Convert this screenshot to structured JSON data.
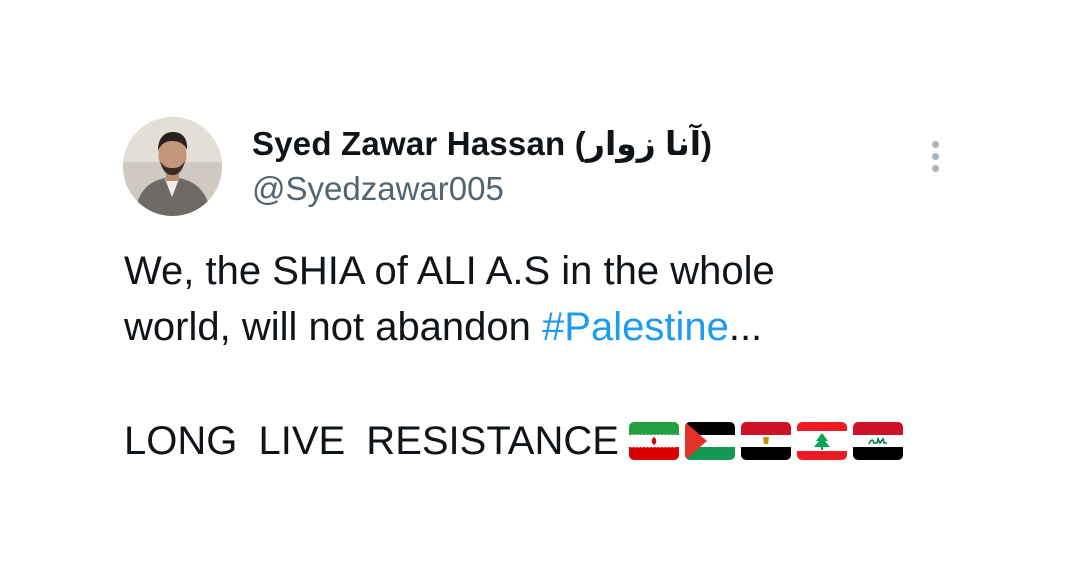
{
  "tweet": {
    "author_name": "Syed Zawar Hassan (آنا زوار)",
    "author_handle": "@Syedzawar005",
    "text_part1": "We, the SHIA of ALI A.S in the whole",
    "text_part2": "world, will not abandon ",
    "hashtag": "#Palestine",
    "ellipsis": "...",
    "text_line3": "LONG  LIVE  RESISTANCE",
    "flags": [
      "iran-flag",
      "palestine-flag",
      "egypt-flag",
      "lebanon-flag",
      "iraq-flag"
    ]
  },
  "colors": {
    "text": "#0f1419",
    "secondary": "#536471",
    "link": "#1d9bf0",
    "more_dots": "#aab4bc"
  },
  "icons": {
    "more": "more-vertical-icon"
  }
}
